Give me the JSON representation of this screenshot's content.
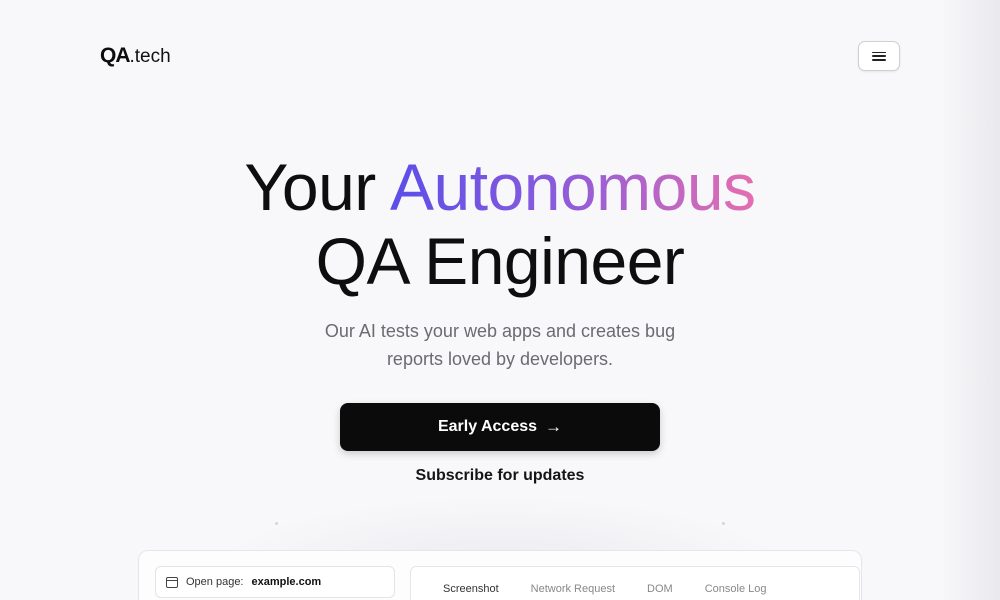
{
  "header": {
    "logo_mark": "QA",
    "logo_suffix": ".tech",
    "menu_icon": "hamburger-menu-icon"
  },
  "hero": {
    "line1_plain": "Your",
    "line1_highlight": "Autonomous",
    "line2": "QA Engineer",
    "gradient_colors": [
      "#5b4ee8",
      "#8a5bdc",
      "#e46fb0"
    ]
  },
  "subtitle": {
    "line1": "Our AI tests your web apps and creates bug",
    "line2": "reports loved by developers."
  },
  "cta": {
    "label": "Early Access",
    "arrow_icon": "arrow-right-icon"
  },
  "subscribe": {
    "label": "Subscribe for updates"
  },
  "preview": {
    "step": {
      "icon": "calendar-icon",
      "prefix": "Open page:",
      "value": "example.com"
    },
    "tabs": [
      "Screenshot",
      "Network Request",
      "DOM",
      "Console Log"
    ],
    "active_tab": "Screenshot"
  }
}
